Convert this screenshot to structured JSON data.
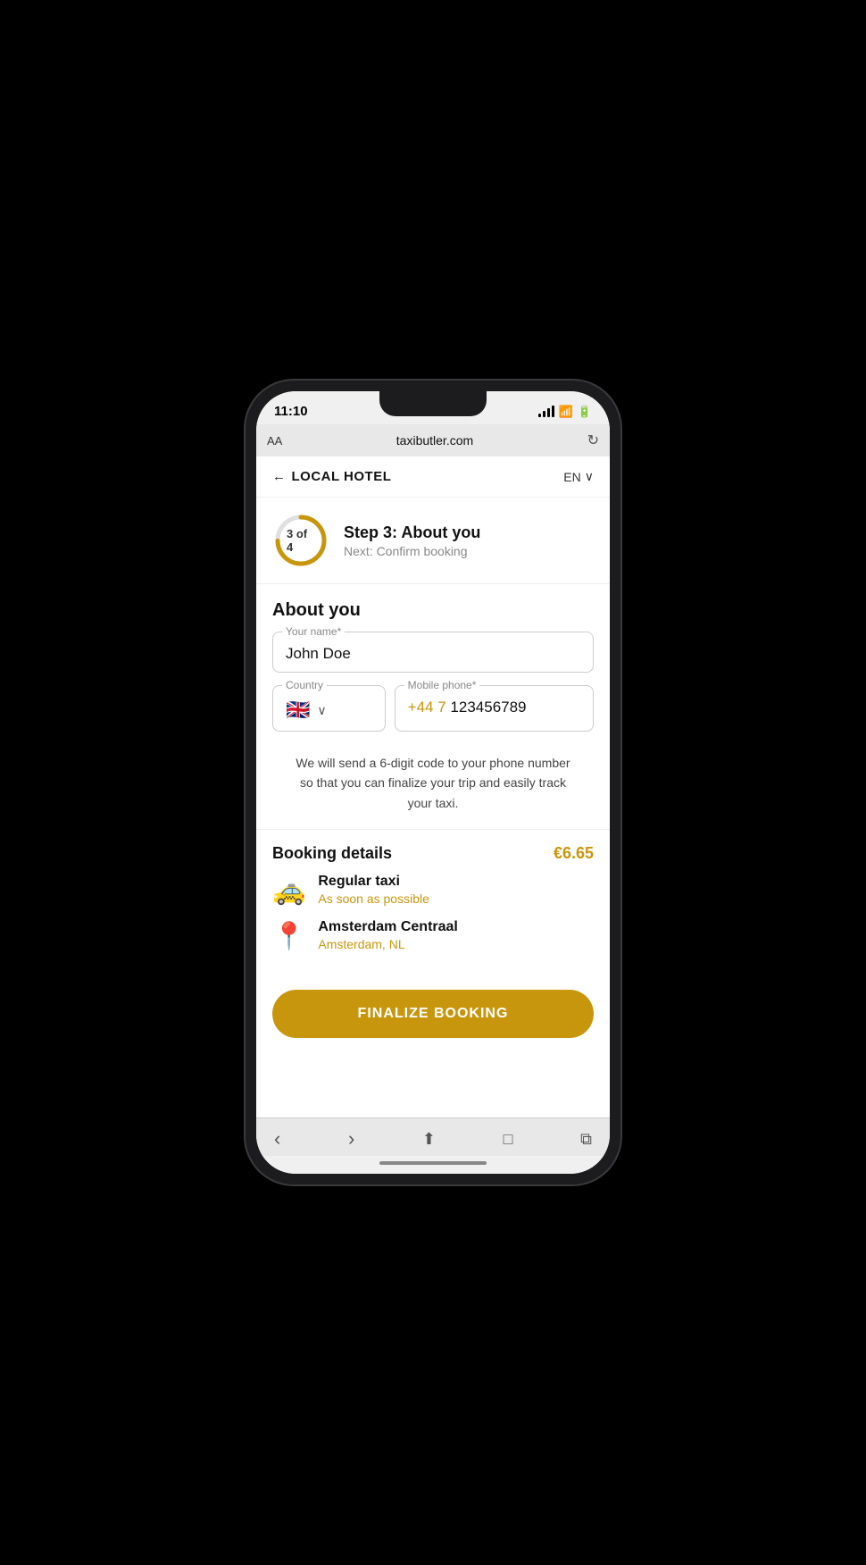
{
  "statusBar": {
    "time": "11:10",
    "locationIcon": "▶"
  },
  "browser": {
    "aa": "AA",
    "url": "taxibutler.com",
    "reload": "↻"
  },
  "nav": {
    "backArrow": "←",
    "hotelName": "LOCAL HOTEL",
    "language": "EN",
    "chevronDown": "∨"
  },
  "step": {
    "current": 3,
    "total": 4,
    "label": "3 of 4",
    "title": "Step 3: About you",
    "next": "Next: Confirm booking",
    "progress": 75
  },
  "aboutYou": {
    "sectionTitle": "About you",
    "nameLabel": "Your name*",
    "nameValue": "John Doe",
    "countryLabel": "Country",
    "flag": "🇬🇧",
    "phoneLabelText": "Mobile phone*",
    "phonePrefix": "+44 7",
    "phoneNumber": "123456789",
    "smsNotice": "We will send a 6-digit code to your phone number so that you can finalize your trip and easily track your taxi."
  },
  "booking": {
    "title": "Booking details",
    "price": "€6.65",
    "items": [
      {
        "icon": "🚕",
        "title": "Regular taxi",
        "subtitle": "As soon as possible"
      },
      {
        "icon": "📍",
        "title": "Amsterdam Centraal",
        "subtitle": "Amsterdam, NL"
      }
    ],
    "finalizeLabel": "FINALIZE BOOKING"
  },
  "bottomNav": {
    "back": "‹",
    "forward": "›",
    "share": "⬆",
    "bookmarks": "□",
    "tabs": "⧉"
  }
}
